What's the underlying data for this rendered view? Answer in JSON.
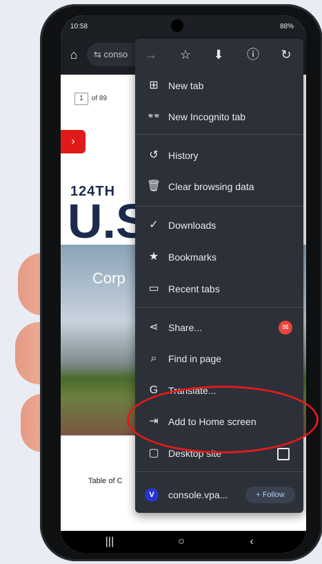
{
  "status_bar": {
    "time": "10:58",
    "battery": "88%"
  },
  "toolbar": {
    "url_text": "⇆ conso"
  },
  "page": {
    "pdf_page": "1",
    "pdf_total": "of 89",
    "banner_text": "124TH",
    "big_text": "U.S",
    "photo_caption": "Corp",
    "toc_title": "Table of C"
  },
  "menu": {
    "items": [
      {
        "label": "New tab",
        "icon": "plus-box-icon"
      },
      {
        "label": "New Incognito tab",
        "icon": "incognito-icon"
      },
      {
        "label": "History",
        "icon": "history-icon"
      },
      {
        "label": "Clear browsing data",
        "icon": "trash-icon"
      },
      {
        "label": "Downloads",
        "icon": "download-check-icon"
      },
      {
        "label": "Bookmarks",
        "icon": "star-icon"
      },
      {
        "label": "Recent tabs",
        "icon": "devices-icon"
      },
      {
        "label": "Share...",
        "icon": "share-icon"
      },
      {
        "label": "Find in page",
        "icon": "find-icon"
      },
      {
        "label": "Translate...",
        "icon": "translate-icon"
      },
      {
        "label": "Add to Home screen",
        "icon": "add-home-icon"
      },
      {
        "label": "Desktop site",
        "icon": "monitor-icon"
      }
    ],
    "profile": {
      "avatar_letter": "V",
      "name": "console.vpa...",
      "follow_label": "+ Follow"
    }
  },
  "colors": {
    "menu_bg": "#2c3038",
    "highlight_circle": "#e21a1a",
    "accent": "#aecbfa"
  }
}
